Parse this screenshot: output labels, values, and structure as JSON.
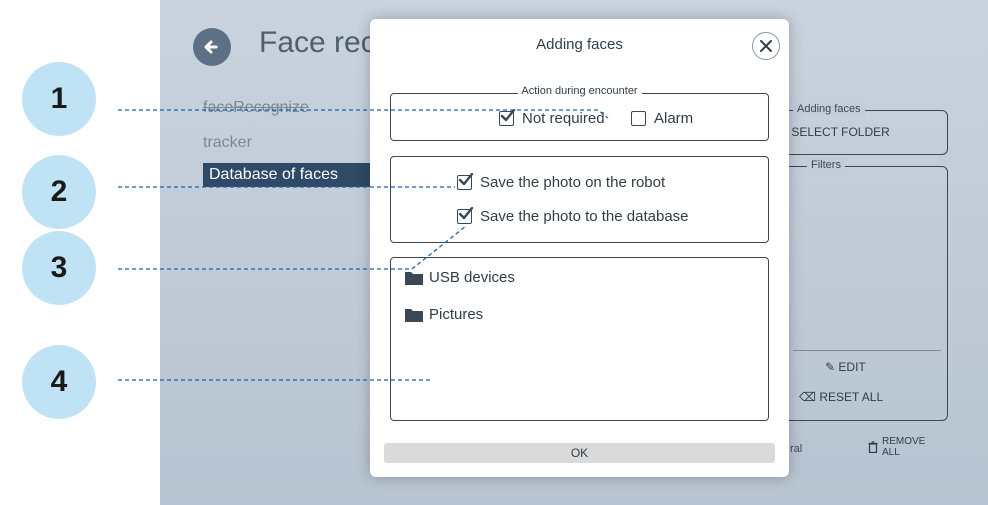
{
  "app": {
    "page_title": "Face rec",
    "sidebar": {
      "items": [
        {
          "label": "faceRecognize"
        },
        {
          "label": "tracker"
        },
        {
          "label": "Database of faces"
        }
      ]
    },
    "right_panel": {
      "adding_faces_legend": "Adding faces",
      "select_folder_label": "+ SELECT FOLDER",
      "filters_legend": "Filters",
      "edit_label": "EDIT",
      "reset_all_label": "RESET ALL",
      "general_fragment": "ral",
      "remove_label_line1": "REMOVE",
      "remove_label_line2": "ALL"
    }
  },
  "dialog": {
    "title": "Adding faces",
    "action_legend": "Action during encounter",
    "not_required_label": "Not required",
    "not_required_checked": true,
    "alarm_label": "Alarm",
    "alarm_checked": false,
    "save_robot_label": "Save the photo on the robot",
    "save_robot_checked": true,
    "save_db_label": "Save the photo to the database",
    "save_db_checked": true,
    "files": [
      {
        "label": "USB devices"
      },
      {
        "label": "Pictures"
      }
    ],
    "ok_label": "OK"
  },
  "callouts": [
    "1",
    "2",
    "3",
    "4"
  ],
  "colors": {
    "callout_fill": "#bfe3f5",
    "leader_line": "#1f5fa8",
    "selected_sidebar": "#2f4a66",
    "app_background": "#c3cdd9"
  }
}
